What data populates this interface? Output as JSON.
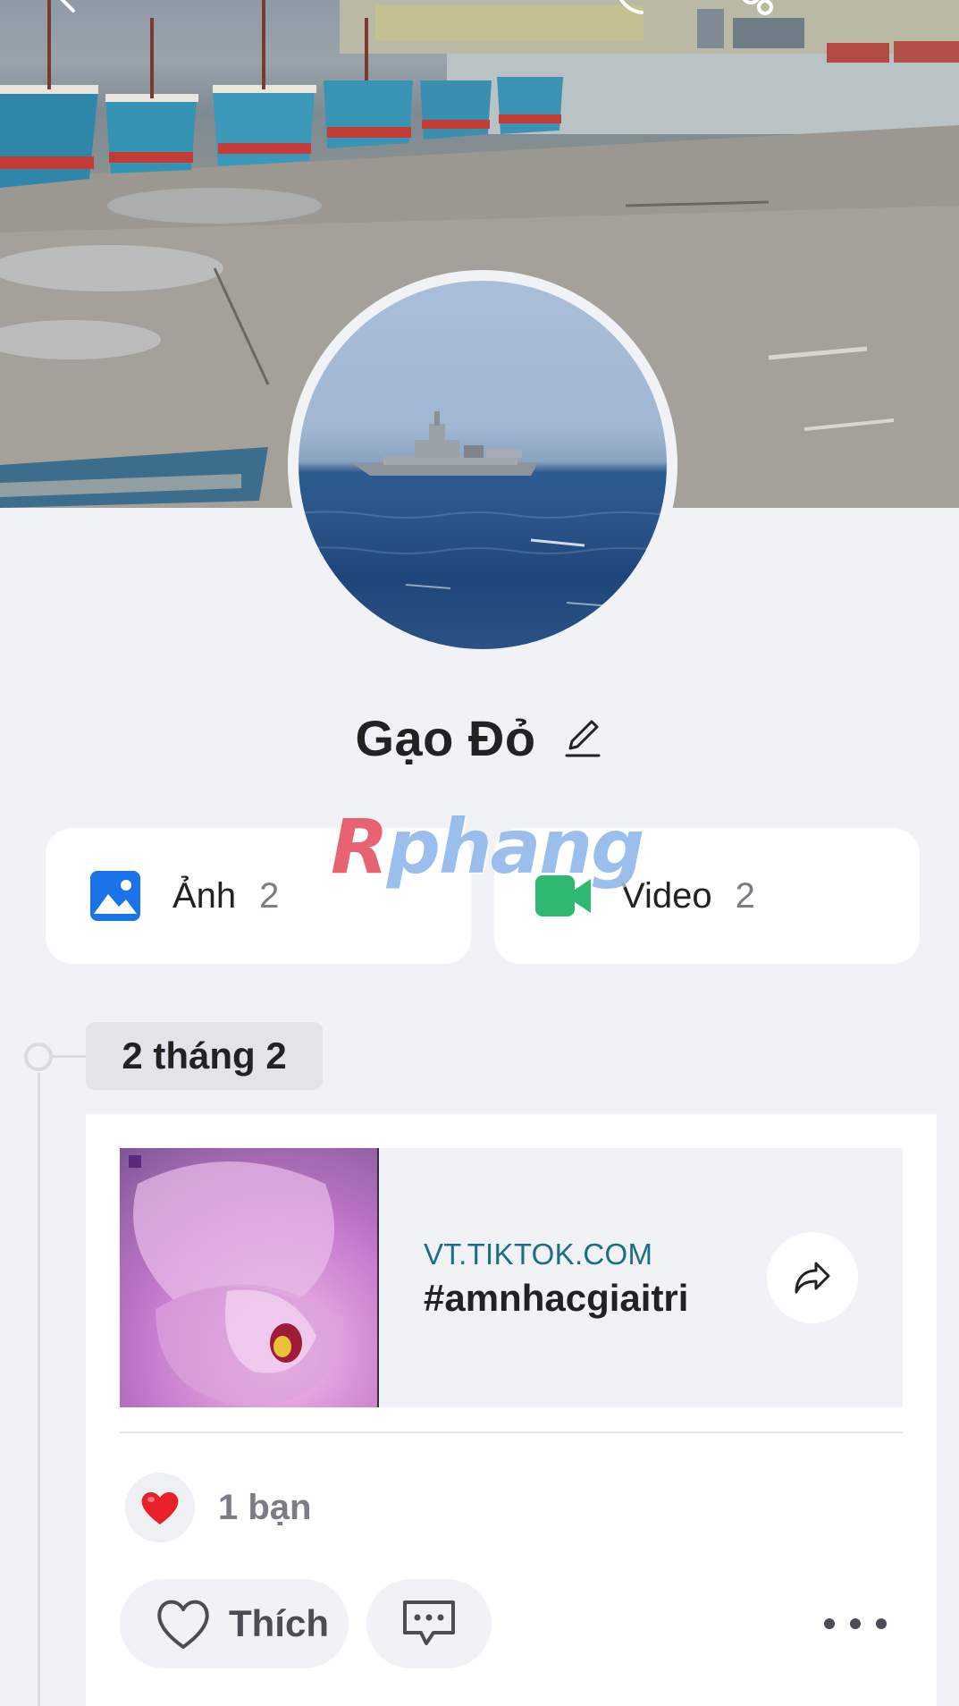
{
  "profile": {
    "name": "Gạo Đỏ"
  },
  "icons": {
    "back": "chevron-left-icon",
    "call": "phone-icon",
    "settings": "user-settings-icon",
    "edit": "pencil-icon",
    "photos": "image-icon",
    "videos": "video-camera-icon",
    "share": "share-arrow-icon",
    "heart": "heart-icon",
    "like": "heart-outline-icon",
    "comment": "comment-icon",
    "more": "more-dots-icon"
  },
  "media": {
    "photos_label": "Ảnh",
    "photos_count": "2",
    "videos_label": "Video",
    "videos_count": "2"
  },
  "watermark": {
    "text_r": "R",
    "text_rest": "phang"
  },
  "timeline": {
    "date_label": "2 tháng 2"
  },
  "post": {
    "link_domain": "VT.TIKTOK.COM",
    "link_title": "#amnhacgiaitri",
    "reaction_text": "1 bạn",
    "like_label": "Thích"
  },
  "colors": {
    "background": "#f1f2f6",
    "card": "#ffffff",
    "photo_icon_blue": "#1a73e8",
    "video_icon_green": "#2fb872",
    "link_domain": "#1b6e86",
    "heart_red": "#e8202a"
  }
}
